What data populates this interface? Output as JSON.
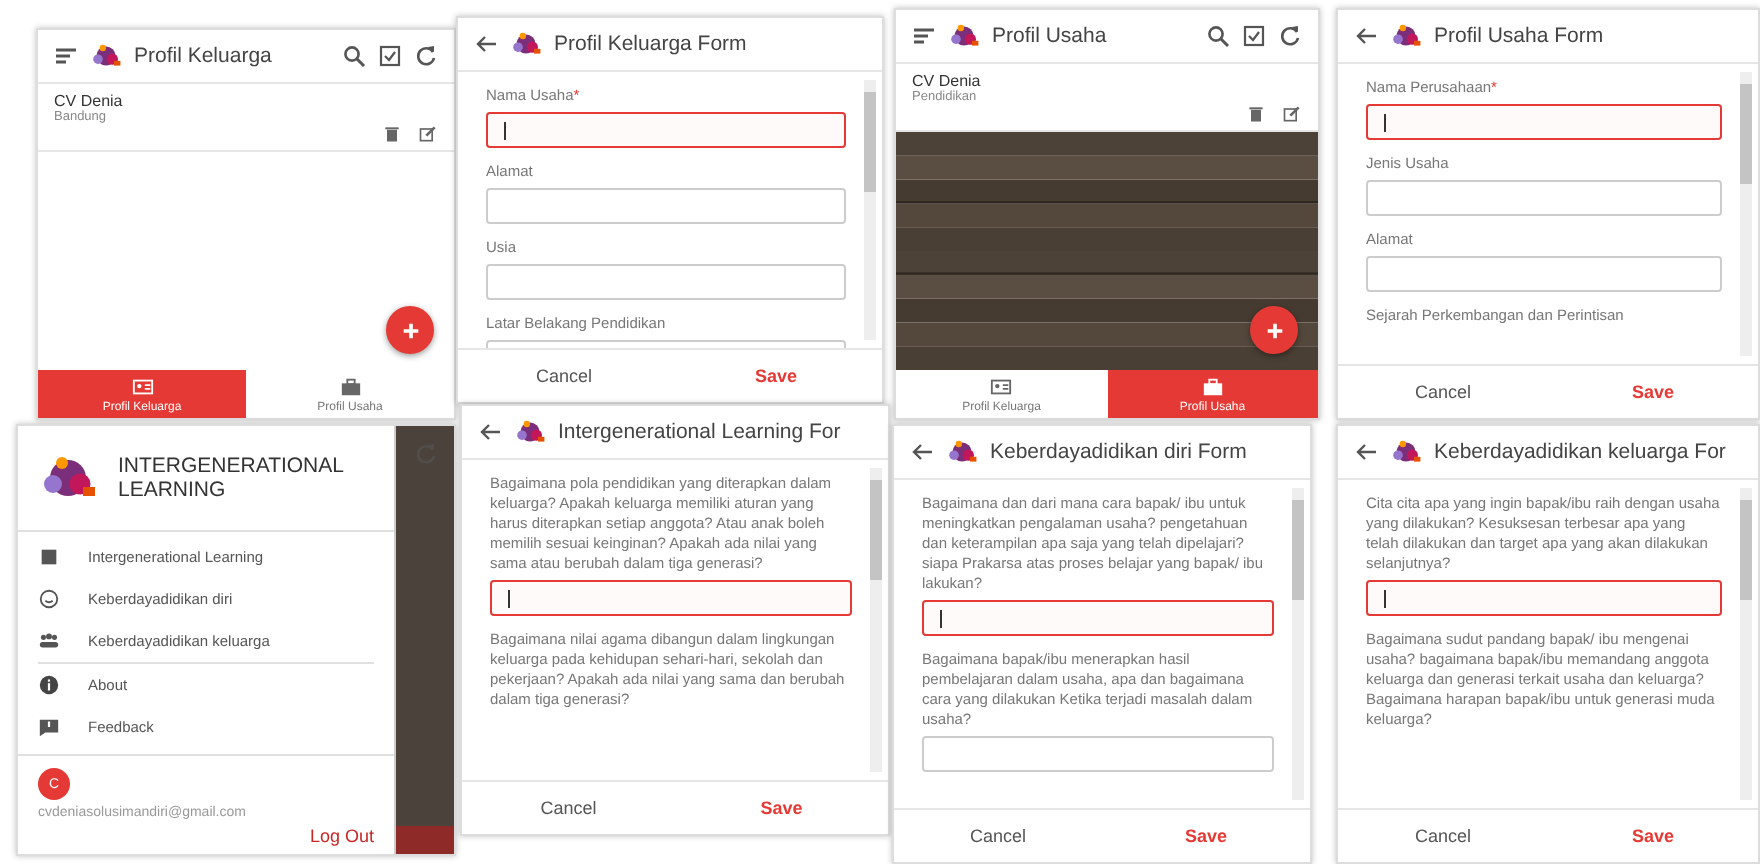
{
  "panels": [
    {
      "kind": "list",
      "title": "Profil Keluarga",
      "items": [
        {
          "name": "CV Denia",
          "subtitle": "Bandung"
        }
      ],
      "picture": false,
      "nav": [
        {
          "label": "Profil Keluarga",
          "selected": true
        },
        {
          "label": "Profil Usaha",
          "selected": false
        }
      ]
    },
    {
      "kind": "form",
      "title": "Profil Keluarga Form",
      "fields": [
        {
          "label": "Nama Usaha",
          "mark": "*",
          "focused": true
        },
        {
          "label": "Alamat",
          "focused": false
        },
        {
          "label": "Usia",
          "focused": false
        },
        {
          "label": "Latar Belakang Pendidikan",
          "focused": false
        }
      ],
      "cancel": "Cancel",
      "save": "Save"
    },
    {
      "kind": "list",
      "title": "Profil Usaha",
      "items": [
        {
          "name": "CV Denia",
          "subtitle": "Pendidikan"
        }
      ],
      "picture": true,
      "nav": [
        {
          "label": "Profil Keluarga",
          "selected": false
        },
        {
          "label": "Profil Usaha",
          "selected": true
        }
      ]
    },
    {
      "kind": "form",
      "title": "Profil Usaha Form",
      "fields": [
        {
          "label": "Nama Perusahaan",
          "mark": "*",
          "focused": true
        },
        {
          "label": "Jenis Usaha",
          "focused": false
        },
        {
          "label": "Alamat",
          "focused": false
        },
        {
          "label": "Sejarah Perkembangan dan Perintisan"
        }
      ],
      "cancel": "Cancel",
      "save": "Save"
    },
    {
      "kind": "drawer",
      "title": "INTERGENERATIONAL LEARNING",
      "sections": [
        [
          {
            "label": "Intergenerational Learning"
          },
          {
            "label": "Keberdayadidikan diri"
          },
          {
            "label": "Keberdayadidikan keluarga"
          }
        ],
        [
          {
            "label": "About"
          },
          {
            "label": "Feedback"
          }
        ]
      ],
      "avatar": "C",
      "email": "cvdeniasolusimandiri@gmail.com",
      "logout": "Log Out"
    },
    {
      "kind": "form",
      "title": "Intergenerational Learning For",
      "fields": [
        {
          "label": "Bagaimana pola pendidikan yang diterapkan dalam keluarga? Apakah keluarga memiliki aturan yang harus diterapkan setiap anggota? Atau anak boleh memilih sesuai keinginan? Apakah ada nilai yang sama atau berubah dalam tiga generasi?",
          "focused": true
        },
        {
          "label": "Bagaimana nilai agama dibangun dalam lingkungan keluarga pada kehidupan sehari-hari, sekolah dan pekerjaan? Apakah ada nilai yang sama dan berubah dalam tiga generasi?"
        }
      ],
      "cancel": "Cancel",
      "save": "Save"
    },
    {
      "kind": "form",
      "title": "Keberdayadidikan diri Form",
      "fields": [
        {
          "label": "Bagaimana dan dari mana cara bapak/ ibu untuk meningkatkan pengalaman usaha? pengetahuan dan keterampilan apa saja yang telah dipelajari? siapa Prakarsa atas proses belajar yang bapak/ ibu lakukan?",
          "focused": true
        },
        {
          "label": "Bagaimana bapak/ibu menerapkan hasil pembelajaran dalam usaha, apa dan bagaimana cara yang dilakukan Ketika terjadi masalah dalam usaha?",
          "focused": false
        }
      ],
      "cancel": "Cancel",
      "save": "Save"
    },
    {
      "kind": "form",
      "title": "Keberdayadidikan keluarga For",
      "fields": [
        {
          "label": "Cita cita apa yang ingin bapak/ibu raih dengan usaha yang dilakukan? Kesuksesan terbesar apa yang telah dilakukan dan target apa yang akan dilakukan selanjutnya?",
          "focused": true
        },
        {
          "label": "Bagaimana sudut pandang bapak/ ibu mengenai usaha? bagaimana bapak/ibu memandang anggota keluarga dan generasi terkait usaha dan keluarga? Bagaimana harapan bapak/ibu untuk generasi muda keluarga?"
        }
      ],
      "cancel": "Cancel",
      "save": "Save"
    }
  ]
}
